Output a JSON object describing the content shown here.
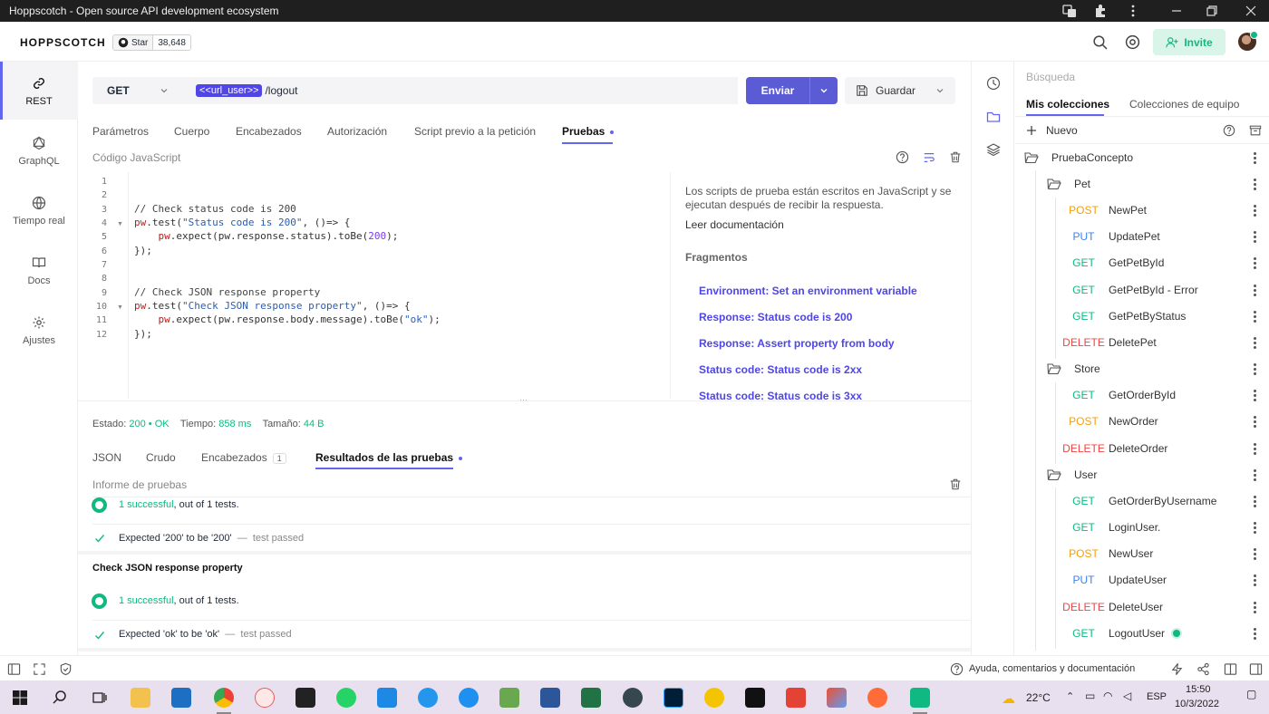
{
  "window": {
    "title": "Hoppscotch - Open source API development ecosystem"
  },
  "header": {
    "brand": "HOPPSCOTCH",
    "star_label": "Star",
    "star_count": "38,648",
    "invite_label": "Invite"
  },
  "nav": {
    "items": [
      {
        "label": "REST",
        "icon": "link-icon",
        "active": true
      },
      {
        "label": "GraphQL",
        "icon": "graphql-icon"
      },
      {
        "label": "Tiempo real",
        "icon": "globe-icon"
      },
      {
        "label": "Docs",
        "icon": "book-icon"
      },
      {
        "label": "Ajustes",
        "icon": "gear-icon"
      }
    ]
  },
  "request": {
    "method": "GET",
    "url_variable": "<<url_user>>",
    "url_path": "/logout",
    "send_label": "Enviar",
    "save_label": "Guardar"
  },
  "tabs": [
    "Parámetros",
    "Cuerpo",
    "Encabezados",
    "Autorización",
    "Script previo a la petición",
    "Pruebas"
  ],
  "editor": {
    "label": "Código JavaScript",
    "lines": [
      "",
      "",
      "// Check status code is 200",
      "pw.test(\"Status code is 200\", ()=> {",
      "    pw.expect(pw.response.status).toBe(200);",
      "});",
      "",
      "",
      "// Check JSON response property",
      "pw.test(\"Check JSON response property\", ()=> {",
      "    pw.expect(pw.response.body.message).toBe(\"ok\");",
      "});"
    ]
  },
  "help": {
    "description": "Los scripts de prueba están escritos en JavaScript y se ejecutan después de recibir la respuesta.",
    "docs_link": "Leer documentación",
    "snippets_title": "Fragmentos",
    "snippets": [
      "Environment: Set an environment variable",
      "Response: Status code is 200",
      "Response: Assert property from body",
      "Status code: Status code is 2xx",
      "Status code: Status code is 3xx"
    ]
  },
  "response": {
    "status_label": "Estado:",
    "status_code": "200",
    "status_text": "OK",
    "time_label": "Tiempo:",
    "time_value": "858 ms",
    "size_label": "Tamaño:",
    "size_value": "44 B",
    "tabs": [
      "JSON",
      "Crudo",
      "Encabezados",
      "Resultados de las pruebas"
    ],
    "headers_count": "1",
    "report_label": "Informe de pruebas",
    "groups": [
      {
        "title": "",
        "summary_count": "1 successful",
        "summary_rest": ", out of 1 tests.",
        "expectation": "Expected '200' to be '200'",
        "dash": "—",
        "result": "test passed"
      },
      {
        "title": "Check JSON response property",
        "summary_count": "1 successful",
        "summary_rest": ", out of 1 tests.",
        "expectation": "Expected 'ok' to be 'ok'",
        "dash": "—",
        "result": "test passed"
      }
    ]
  },
  "collections": {
    "search_placeholder": "Búsqueda",
    "tabs": [
      "Mis colecciones",
      "Colecciones de equipo"
    ],
    "new_label": "Nuevo",
    "root": "PruebaConcepto",
    "folders": [
      {
        "name": "Pet",
        "requests": [
          {
            "method": "POST",
            "name": "NewPet"
          },
          {
            "method": "PUT",
            "name": "UpdatePet"
          },
          {
            "method": "GET",
            "name": "GetPetById"
          },
          {
            "method": "GET",
            "name": "GetPetById - Error"
          },
          {
            "method": "GET",
            "name": "GetPetByStatus"
          },
          {
            "method": "DELETE",
            "name": "DeletePet"
          }
        ]
      },
      {
        "name": "Store",
        "requests": [
          {
            "method": "GET",
            "name": "GetOrderById"
          },
          {
            "method": "POST",
            "name": "NewOrder"
          },
          {
            "method": "DELETE",
            "name": "DeleteOrder"
          }
        ]
      },
      {
        "name": "User",
        "requests": [
          {
            "method": "GET",
            "name": "GetOrderByUsername"
          },
          {
            "method": "GET",
            "name": "LoginUser."
          },
          {
            "method": "POST",
            "name": "NewUser"
          },
          {
            "method": "PUT",
            "name": "UpdateUser"
          },
          {
            "method": "DELETE",
            "name": "DeleteUser"
          },
          {
            "method": "GET",
            "name": "LogoutUser"
          }
        ]
      }
    ]
  },
  "footer": {
    "help_label": "Ayuda, comentarios y documentación"
  },
  "taskbar": {
    "apps": [
      "windows-start-icon",
      "search-icon",
      "task-view-icon",
      "file-explorer-icon",
      "mail-icon",
      "chrome-icon",
      "ai-app-icon",
      "terminal-icon",
      "whatsapp-icon",
      "vscode-icon",
      "docker-icon",
      "postman-icon",
      "minecraft-icon",
      "word-icon",
      "excel-icon",
      "database-icon",
      "photoshop-icon",
      "settings-app-icon",
      "intellij-icon",
      "brave-icon",
      "git-icon",
      "postman-orange-icon",
      "hoppscotch-icon"
    ],
    "weather": "22°C",
    "lang": "ESP",
    "time": "15:50",
    "date": "10/3/2022"
  },
  "colors": {
    "accent": "#6366f1",
    "success": "#10b981",
    "post": "#f59e0b",
    "put": "#3b82f6",
    "delete": "#ef4444"
  }
}
